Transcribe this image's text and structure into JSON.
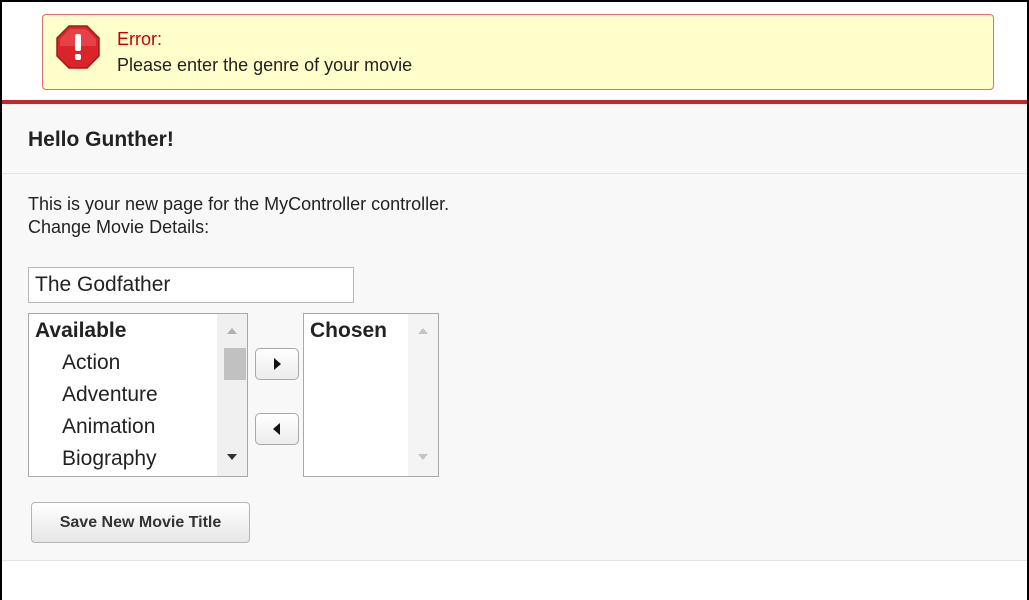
{
  "error": {
    "title": "Error:",
    "message": "Please enter the genre of your movie",
    "icon": "error-stop-icon"
  },
  "page": {
    "greeting": "Hello Gunther!",
    "intro_line_1": "This is your new page for the MyController controller.",
    "intro_line_2": "Change Movie Details:"
  },
  "form": {
    "movie_title_value": "The Godfather",
    "available": {
      "header": "Available",
      "items": [
        "Action",
        "Adventure",
        "Animation",
        "Biography"
      ]
    },
    "chosen": {
      "header": "Chosen",
      "items": []
    },
    "add_icon": "arrow-right-icon",
    "remove_icon": "arrow-left-icon",
    "save_label": "Save New Movie Title"
  },
  "colors": {
    "error_bg": "#ffffcc",
    "error_border": "#e07070",
    "error_title": "#cc0000",
    "accent_rule": "#c1272d",
    "page_bg": "#f8f8f8"
  }
}
